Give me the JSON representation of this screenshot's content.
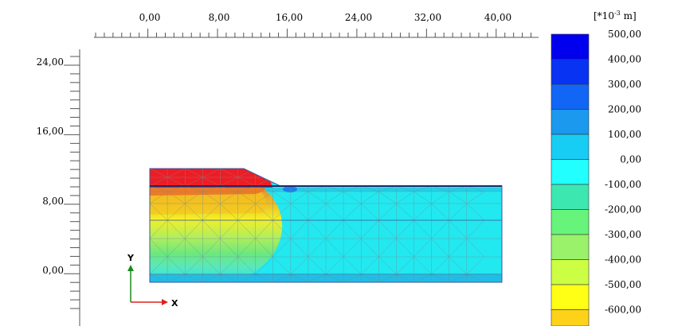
{
  "ruler": {
    "x_labels": [
      "0,00",
      "8,00",
      "16,00",
      "24,00",
      "32,00",
      "40,00"
    ],
    "y_labels": [
      "24,00",
      "16,00",
      "8,00",
      "0,00"
    ]
  },
  "axes_indicator": {
    "x": "X",
    "y": "Y"
  },
  "legend": {
    "unit_prefix": "[*10",
    "unit_exp": "-3",
    "unit_suffix": " m]",
    "entries": [
      {
        "label": "500,00",
        "color": "#0000ee"
      },
      {
        "label": "400,00",
        "color": "#0833f3"
      },
      {
        "label": "300,00",
        "color": "#1266f5"
      },
      {
        "label": "200,00",
        "color": "#1a99ef"
      },
      {
        "label": "100,00",
        "color": "#17cdf4"
      },
      {
        "label": "0,00",
        "color": "#22ffff"
      },
      {
        "label": "-100,00",
        "color": "#3de8b0"
      },
      {
        "label": "-200,00",
        "color": "#66f57a"
      },
      {
        "label": "-300,00",
        "color": "#99f26a"
      },
      {
        "label": "-400,00",
        "color": "#ccff44"
      },
      {
        "label": "-500,00",
        "color": "#ffff16"
      },
      {
        "label": "-600,00",
        "color": "#ffd21a"
      },
      {
        "label": "",
        "color": "#ffa611"
      }
    ]
  },
  "colors": {
    "red_zone": "#ee1c24",
    "orange": "#f5a015",
    "yellow": "#ffe81a",
    "light_green": "#aaea5c",
    "green": "#66e87a",
    "mint": "#55e8c0",
    "cyan": "#22e8f0",
    "mesh_line": "#7a9a9a",
    "layer_line": "#1b3a8a"
  }
}
